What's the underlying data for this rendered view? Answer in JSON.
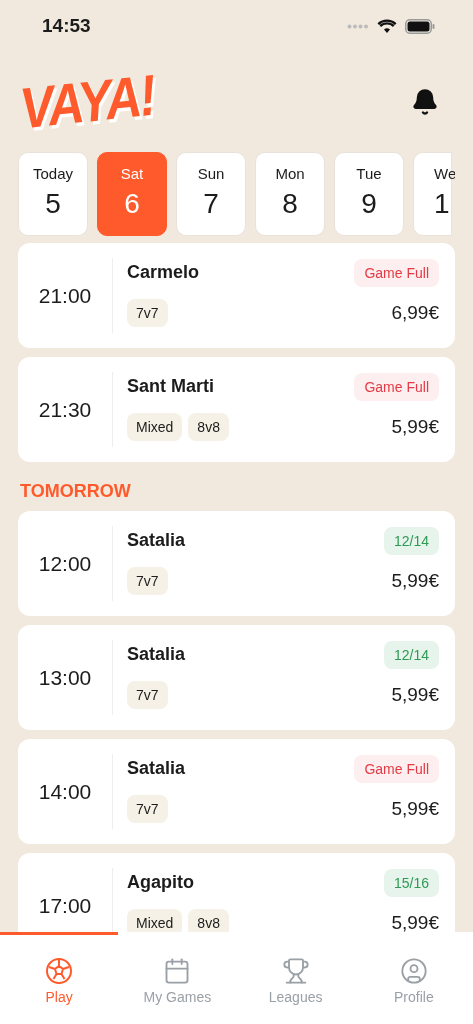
{
  "status_bar": {
    "time": "14:53"
  },
  "header": {
    "logo": "VAYA!"
  },
  "days": [
    {
      "weekday": "Today",
      "day": "5",
      "selected": false,
      "cut": false
    },
    {
      "weekday": "Sat",
      "day": "6",
      "selected": true,
      "cut": false
    },
    {
      "weekday": "Sun",
      "day": "7",
      "selected": false,
      "cut": false
    },
    {
      "weekday": "Mon",
      "day": "8",
      "selected": false,
      "cut": false
    },
    {
      "weekday": "Tue",
      "day": "9",
      "selected": false,
      "cut": false
    },
    {
      "weekday": "We",
      "day": "1",
      "selected": false,
      "cut": true
    }
  ],
  "sections": [
    {
      "games": [
        {
          "time": "21:00",
          "venue": "Carmelo",
          "status": {
            "kind": "full",
            "text": "Game Full"
          },
          "tags": [
            "7v7"
          ],
          "price": "6,99€"
        },
        {
          "time": "21:30",
          "venue": "Sant Marti",
          "status": {
            "kind": "full",
            "text": "Game Full"
          },
          "tags": [
            "Mixed",
            "8v8"
          ],
          "price": "5,99€"
        }
      ]
    },
    {
      "title": "TOMORROW",
      "games": [
        {
          "time": "12:00",
          "venue": "Satalia",
          "status": {
            "kind": "spots",
            "text": "12/14"
          },
          "tags": [
            "7v7"
          ],
          "price": "5,99€"
        },
        {
          "time": "13:00",
          "venue": "Satalia",
          "status": {
            "kind": "spots",
            "text": "12/14"
          },
          "tags": [
            "7v7"
          ],
          "price": "5,99€"
        },
        {
          "time": "14:00",
          "venue": "Satalia",
          "status": {
            "kind": "full",
            "text": "Game Full"
          },
          "tags": [
            "7v7"
          ],
          "price": "5,99€"
        },
        {
          "time": "17:00",
          "venue": "Agapito",
          "status": {
            "kind": "spots",
            "text": "15/16"
          },
          "tags": [
            "Mixed",
            "8v8"
          ],
          "price": "5,99€"
        }
      ]
    }
  ],
  "tab_bar": [
    {
      "kind": "ball",
      "label": "Play",
      "selected": true
    },
    {
      "kind": "calendar",
      "label": "My Games",
      "selected": false
    },
    {
      "kind": "trophy",
      "label": "Leagues",
      "selected": false
    },
    {
      "kind": "profile",
      "label": "Profile",
      "selected": false
    }
  ]
}
